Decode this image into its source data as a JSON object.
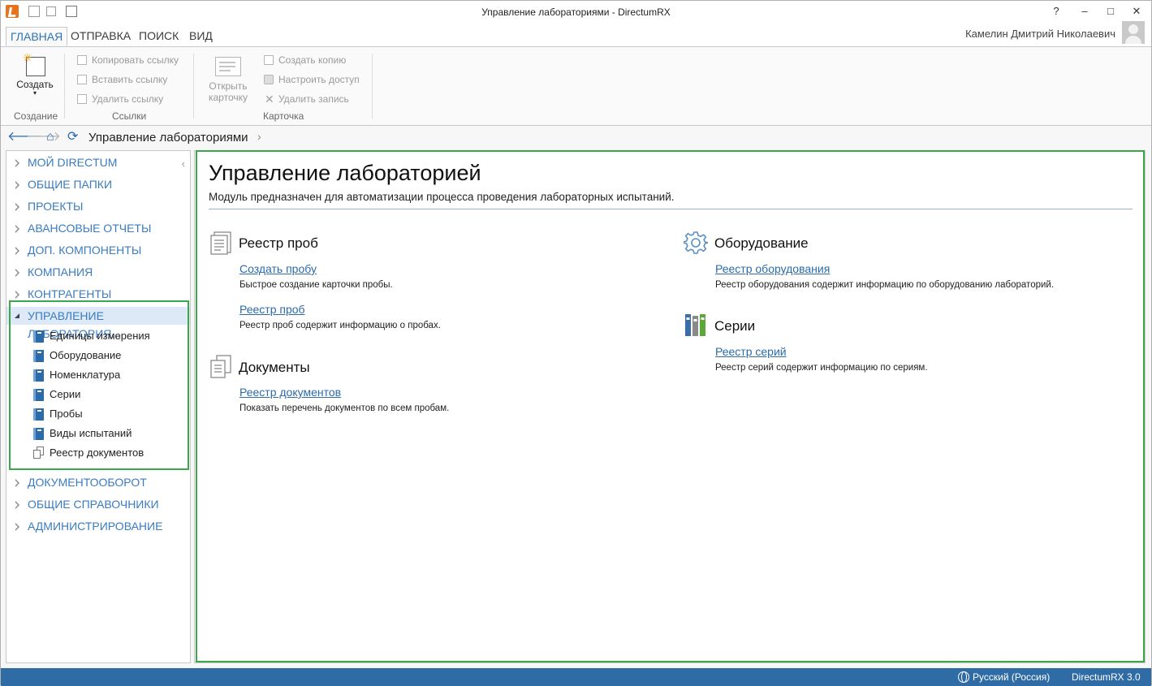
{
  "window": {
    "title": "Управление лабораториями - DirectumRX",
    "controls": {
      "help": "?",
      "minimize": "–",
      "maximize": "□",
      "close": "✕"
    }
  },
  "ribbon_tabs": [
    "ГЛАВНАЯ",
    "ОТПРАВКА",
    "ПОИСК",
    "ВИД"
  ],
  "user": {
    "name": "Камелин Дмитрий Николаевич"
  },
  "ribbon": {
    "create": {
      "label": "Создать",
      "arrow": "▾",
      "group": "Создание"
    },
    "links": {
      "group": "Ссылки",
      "items": [
        "Копировать ссылку",
        "Вставить ссылку",
        "Удалить ссылку"
      ]
    },
    "card": {
      "group": "Карточка",
      "open_label_1": "Открыть",
      "open_label_2": "карточку",
      "items": [
        "Создать копию",
        "Настроить доступ",
        "Удалить запись"
      ]
    }
  },
  "navbar": {
    "breadcrumb": "Управление лабораториями",
    "chevron": "›"
  },
  "sidebar": {
    "collapse": "‹",
    "items_before": [
      "МОЙ DIRECTUM",
      "ОБЩИЕ ПАПКИ",
      "ПРОЕКТЫ",
      "АВАНСОВЫЕ ОТЧЕТЫ",
      "ДОП. КОМПОНЕНТЫ",
      "КОМПАНИЯ",
      "КОНТРАГЕНТЫ"
    ],
    "expanded": "УПРАВЛЕНИЕ ЛАБОРАТОРИЯ...",
    "sub_items": [
      "Единицы измерения",
      "Оборудование",
      "Номенклатура",
      "Серии",
      "Пробы",
      "Виды испытаний",
      "Реестр документов"
    ],
    "items_after": [
      "ДОКУМЕНТООБОРОТ",
      "ОБЩИЕ СПРАВОЧНИКИ",
      "АДМИНИСТРИРОВАНИЕ"
    ]
  },
  "main": {
    "title": "Управление лабораторией",
    "description": "Модуль предназначен для автоматизации процесса проведения лабораторных испытаний.",
    "sections": {
      "samples": {
        "title": "Реестр проб",
        "links": [
          {
            "label": "Создать пробу",
            "desc": "Быстрое создание карточки пробы."
          },
          {
            "label": "Реестр проб",
            "desc": "Реестр проб содержит информацию о пробах."
          }
        ]
      },
      "documents": {
        "title": "Документы",
        "links": [
          {
            "label": "Реестр документов",
            "desc": "Показать перечень документов по всем пробам."
          }
        ]
      },
      "equipment": {
        "title": "Оборудование",
        "links": [
          {
            "label": "Реестр оборудования",
            "desc": "Реестр оборудования содержит информацию по оборудованию лабораторий."
          }
        ]
      },
      "series": {
        "title": "Серии",
        "links": [
          {
            "label": "Реестр серий",
            "desc": "Реестр серий содержит информацию по сериям."
          }
        ]
      }
    }
  },
  "statusbar": {
    "language": "Русский (Россия)",
    "version": "DirectumRX 3.0"
  },
  "colors": {
    "accent": "#2b73b7",
    "link": "#2c6aa8",
    "highlight": "#3aa84a",
    "status": "#2f6ca6"
  }
}
